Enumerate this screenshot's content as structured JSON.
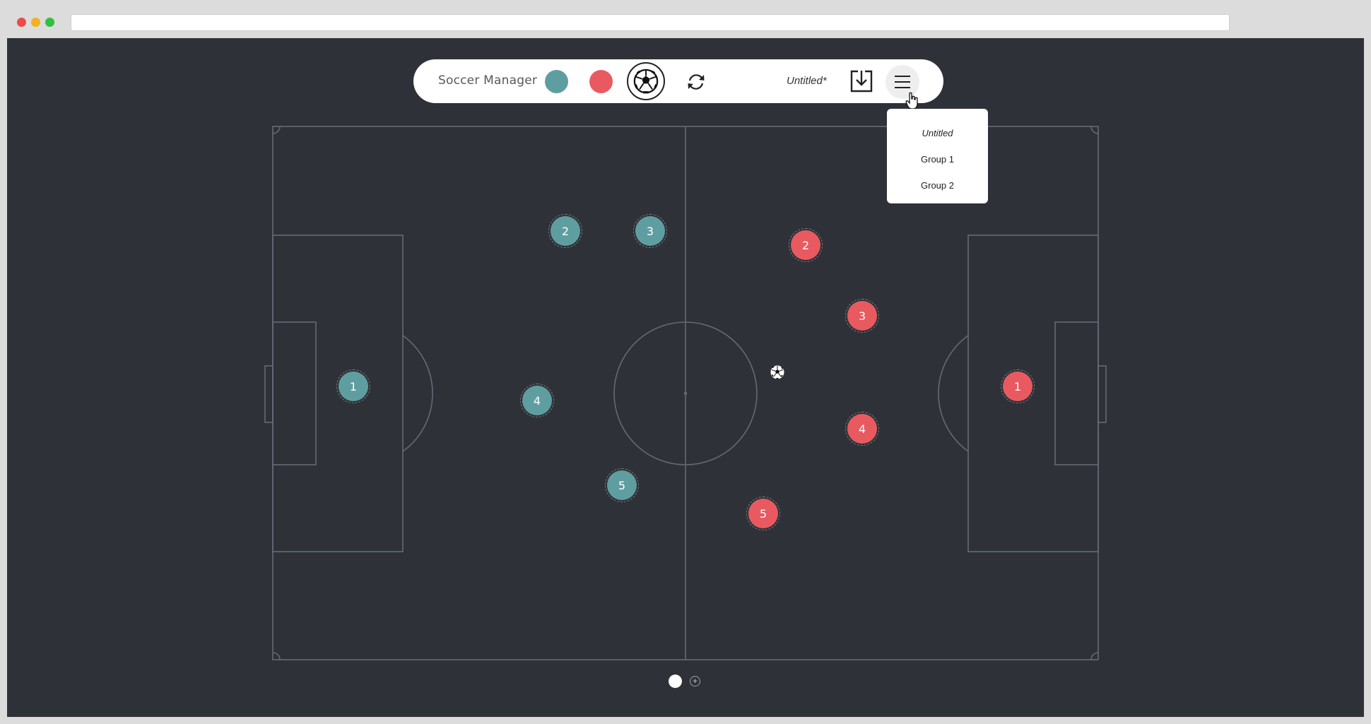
{
  "app": {
    "title": "Soccer Manager",
    "document_name": "Untitled*"
  },
  "toolbar": {
    "team_colors": {
      "teal": "#5f9ea0",
      "red": "#e85a5f"
    },
    "icons": {
      "team_teal": "teal-team-icon",
      "team_red": "red-team-icon",
      "ball": "soccer-ball-icon",
      "swap": "swap-sides-icon",
      "save": "download-icon",
      "menu": "hamburger-menu-icon"
    }
  },
  "menu": {
    "items": [
      {
        "label": "Untitled",
        "current": true
      },
      {
        "label": "Group 1",
        "current": false
      },
      {
        "label": "Group 2",
        "current": false
      }
    ]
  },
  "pitch": {
    "line_color": "#6b7079",
    "background": "#2e3238"
  },
  "teams": {
    "teal": {
      "color": "#5f9ea0",
      "players": [
        "1",
        "2",
        "3",
        "4",
        "5"
      ]
    },
    "red": {
      "color": "#e85a5f",
      "players": [
        "1",
        "2",
        "3",
        "4",
        "5"
      ]
    }
  },
  "pagination": {
    "pages": 1,
    "current": 1,
    "add_label": "+"
  }
}
